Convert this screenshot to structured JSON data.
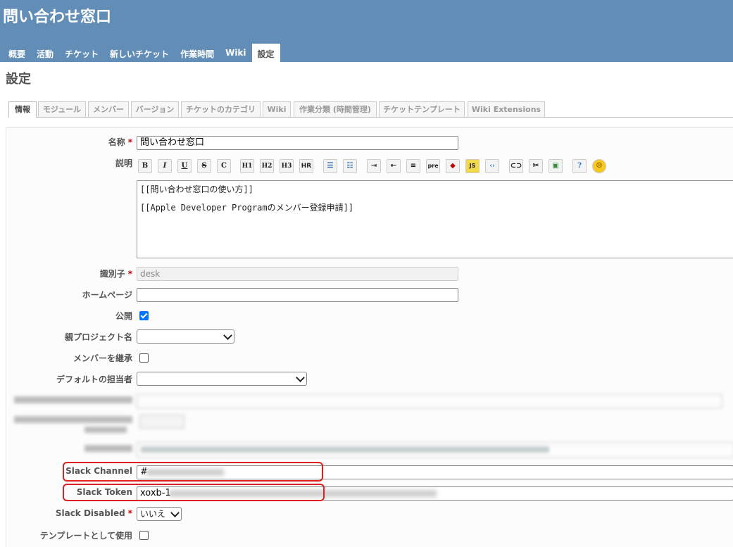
{
  "project": {
    "title": "問い合わせ窓口"
  },
  "main_menu": [
    {
      "label": "概要"
    },
    {
      "label": "活動"
    },
    {
      "label": "チケット"
    },
    {
      "label": "新しいチケット"
    },
    {
      "label": "作業時間"
    },
    {
      "label": "Wiki"
    },
    {
      "label": "設定",
      "selected": true
    }
  ],
  "page_title": "設定",
  "tabs": [
    {
      "label": "情報",
      "selected": true
    },
    {
      "label": "モジュール"
    },
    {
      "label": "メンバー"
    },
    {
      "label": "バージョン"
    },
    {
      "label": "チケットのカテゴリ"
    },
    {
      "label": "Wiki"
    },
    {
      "label": "作業分類 (時間管理)"
    },
    {
      "label": "チケットテンプレート"
    },
    {
      "label": "Wiki Extensions"
    }
  ],
  "form": {
    "name": {
      "label": "名称",
      "required_mark": "*",
      "value": "問い合わせ窓口"
    },
    "description": {
      "label": "説明",
      "lines": [
        "[[問い合わせ窓口の使い方]]",
        "[[Apple Developer Programのメンバー登録申請]]"
      ]
    },
    "identifier": {
      "label": "識別子",
      "required_mark": "*",
      "value": "desk"
    },
    "homepage": {
      "label": "ホームページ",
      "value": ""
    },
    "public": {
      "label": "公開",
      "checked": true
    },
    "parent": {
      "label": "親プロジェクト名",
      "value": ""
    },
    "inherit_members": {
      "label": "メンバーを継承",
      "checked": false
    },
    "default_assignee": {
      "label": "デフォルトの担当者",
      "value": ""
    },
    "slack_channel": {
      "label": "Slack Channel",
      "value": "#"
    },
    "slack_token": {
      "label": "Slack Token",
      "value": "xoxb-1"
    },
    "slack_disabled": {
      "label": "Slack Disabled",
      "required_mark": "*",
      "value": "いいえ"
    },
    "use_as_template": {
      "label": "テンプレートとして使用",
      "checked": false
    }
  },
  "toolbar": [
    "B",
    "I",
    "U",
    "S",
    "C",
    "H1",
    "H2",
    "H3",
    "HR",
    "ul",
    "ol",
    "indent",
    "outdent",
    "table",
    "pre",
    "redmine",
    "js",
    "code",
    "link",
    "image-link",
    "image",
    "help",
    "smiley"
  ],
  "colors": {
    "header_bg": "#628db6",
    "highlight": "#e02020",
    "required": "#bb0000"
  }
}
